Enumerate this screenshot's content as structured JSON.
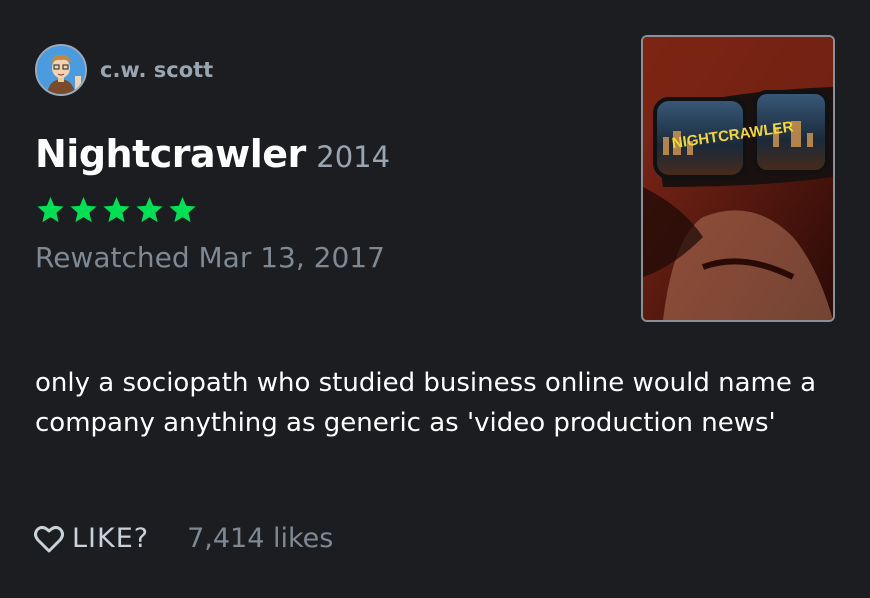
{
  "author": {
    "name": "c.w. scott",
    "avatar_icon": "cartoon-avatar"
  },
  "film": {
    "title": "Nightcrawler",
    "year": "2014"
  },
  "rating": {
    "stars": 5,
    "max": 5,
    "color": "#00e054"
  },
  "watch": {
    "line": "Rewatched Mar 13, 2017"
  },
  "poster": {
    "title_text": "NIGHTCRAWLER"
  },
  "review": {
    "text": "only a sociopath who studied business online would name a company anything as generic as 'video production news'"
  },
  "actions": {
    "like_label": "LIKE?",
    "like_icon": "heart-outline-icon",
    "likes_count": "7,414 likes"
  },
  "colors": {
    "background": "#1b1d21",
    "star": "#00e054",
    "muted": "#9aa5b1"
  }
}
